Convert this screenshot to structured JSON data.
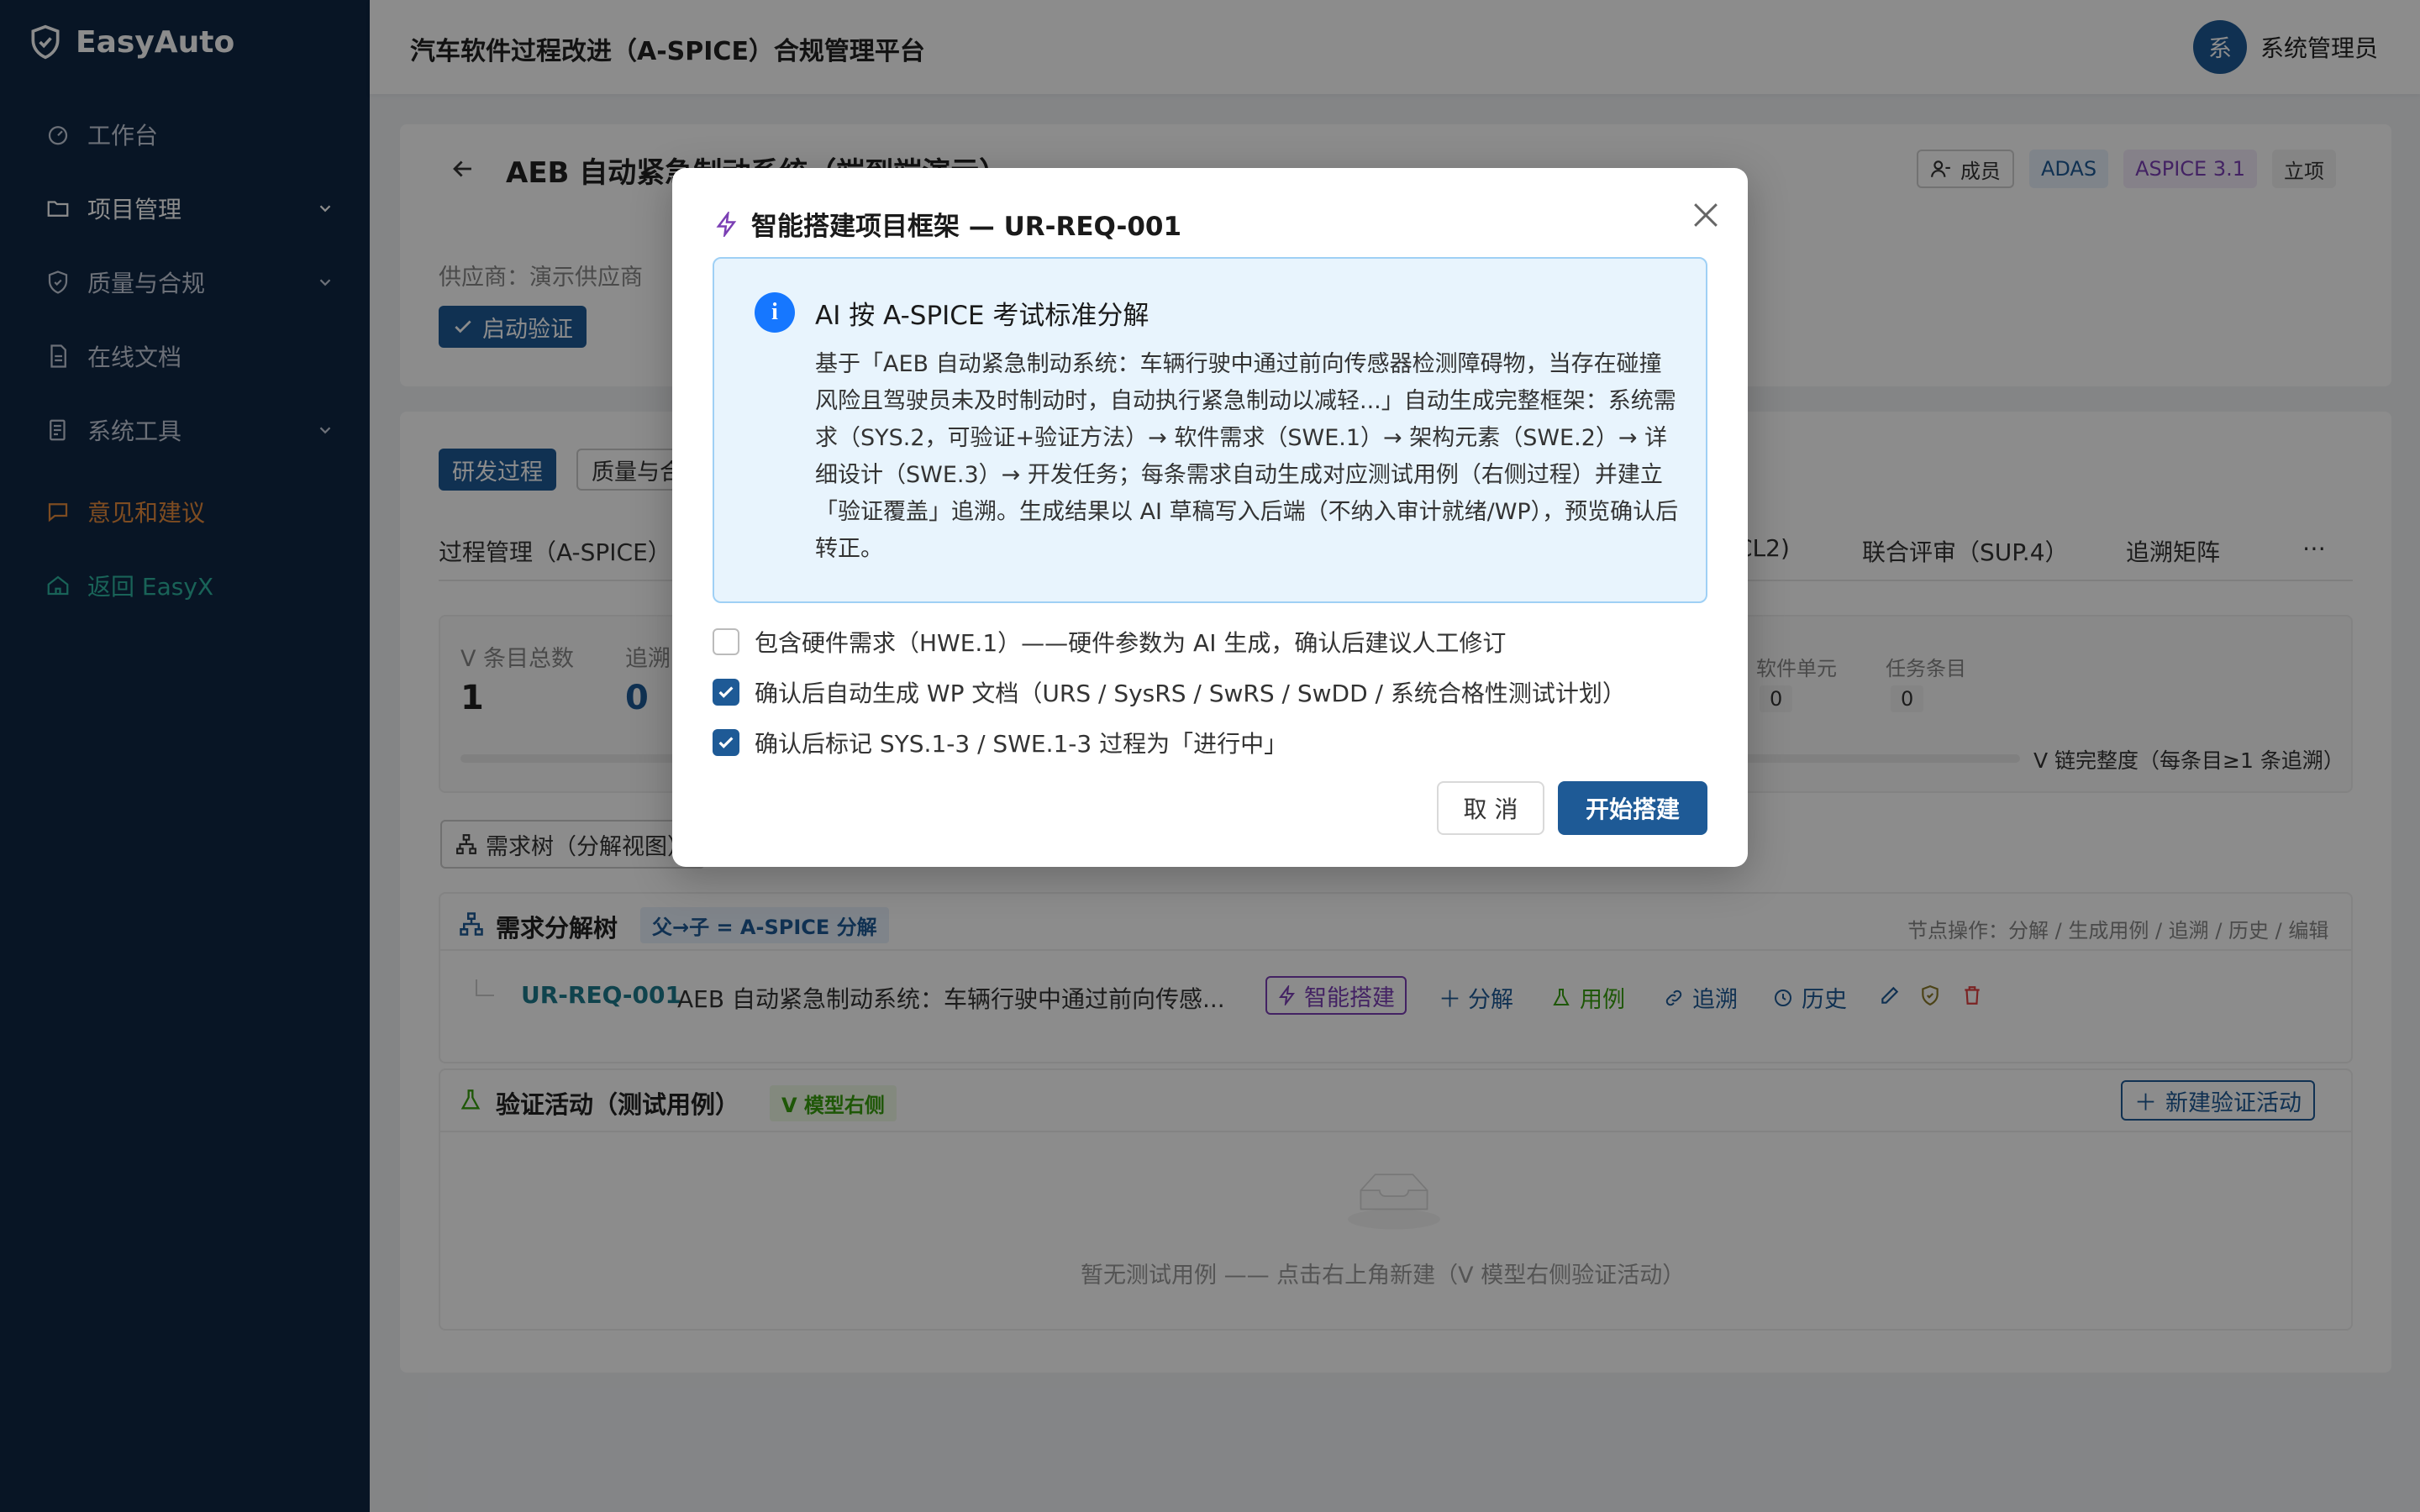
{
  "app": {
    "name": "EasyAuto"
  },
  "sidebar": {
    "items": [
      {
        "label": "工作台"
      },
      {
        "label": "项目管理"
      },
      {
        "label": "质量与合规"
      },
      {
        "label": "在线文档"
      },
      {
        "label": "系统工具"
      },
      {
        "label": "意见和建议"
      },
      {
        "label": "返回 EasyX"
      }
    ]
  },
  "header": {
    "title": "汽车软件过程改进（A-SPICE）合规管理平台",
    "avatar": "系",
    "user": "系统管理员"
  },
  "project": {
    "title": "AEB 自动紧急制动系统（端到端演示）",
    "members": "成员",
    "tags": [
      "ADAS",
      "ASPICE 3.1",
      "立项"
    ],
    "supplier": "供应商：演示供应商",
    "start_button": "启动验证",
    "tabs": [
      "研发过程",
      "质量与合规"
    ],
    "subtabs": [
      "过程管理（A-SPICE）",
      "CL2)",
      "联合评审（SUP.4）",
      "追溯矩阵",
      "⋯"
    ],
    "stats": [
      {
        "label": "V 条目总数",
        "value": "1"
      },
      {
        "label": "追溯",
        "value": "0"
      }
    ],
    "mini_stats": [
      {
        "label": "软件单元",
        "value": "0"
      },
      {
        "label": "任务条目",
        "value": "0"
      }
    ],
    "v_chain": "V 链完整度（每条目≥1 条追溯）",
    "tree_btn": "需求树（分解视图）",
    "tree": {
      "title": "需求分解树",
      "badge": "父→子 = A-SPICE 分解",
      "ops": "节点操作：分解 / 生成用例 / 追溯 / 历史 / 编辑",
      "row_id": "UR-REQ-001",
      "row_text": "AEB 自动紧急制动系统：车辆行驶中通过前向传感...",
      "actions": [
        "智能搭建",
        "分解",
        "用例",
        "追溯",
        "历史"
      ]
    },
    "verify": {
      "title": "验证活动（测试用例）",
      "badge": "V 模型右侧",
      "new_btn": "新建验证活动",
      "empty": "暂无测试用例 —— 点击右上角新建（V 模型右侧验证活动）"
    }
  },
  "modal": {
    "title": "智能搭建项目框架 — UR-REQ-001",
    "info_title": "AI 按 A-SPICE 考试标准分解",
    "info_text": "基于「AEB 自动紧急制动系统：车辆行驶中通过前向传感器检测障碍物，当存在碰撞风险且驾驶员未及时制动时，自动执行紧急制动以减轻...」自动生成完整框架：系统需求（SYS.2，可验证+验证方法）→ 软件需求（SWE.1）→ 架构元素（SWE.2）→ 详细设计（SWE.3）→ 开发任务；每条需求自动生成对应测试用例（右侧过程）并建立「验证覆盖」追溯。生成结果以 AI 草稿写入后端（不纳入审计就绪/WP），预览确认后转正。",
    "options": [
      {
        "label": "包含硬件需求（HWE.1）——硬件参数为 AI 生成，确认后建议人工修订",
        "checked": false
      },
      {
        "label": "确认后自动生成 WP 文档（URS / SysRS / SwRS / SwDD / 系统合格性测试计划）",
        "checked": true
      },
      {
        "label": "确认后标记 SYS.1-3 / SWE.1-3 过程为「进行中」",
        "checked": true
      }
    ],
    "cancel": "取 消",
    "ok": "开始搭建"
  }
}
